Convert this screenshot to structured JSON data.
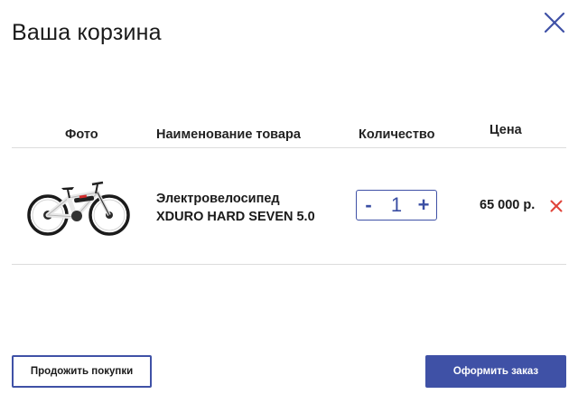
{
  "modal": {
    "title": "Ваша корзина",
    "close_icon": "close-icon"
  },
  "table": {
    "headers": {
      "photo": "Фото",
      "name": "Наименование товара",
      "quantity": "Количество",
      "price": "Цена"
    },
    "items": [
      {
        "image_icon": "bicycle-image",
        "name_line1": "Электровелосипед",
        "name_line2": "XDURO HARD SEVEN 5.0",
        "minus_label": "-",
        "quantity": "1",
        "plus_label": "+",
        "price": "65 000 р.",
        "remove_icon": "remove-icon"
      }
    ]
  },
  "footer": {
    "continue_label": "Продожить покупки",
    "order_label": "Оформить заказ"
  },
  "colors": {
    "accent": "#3f51a6",
    "remove": "#e0443a",
    "divider": "#dcdcdc"
  }
}
